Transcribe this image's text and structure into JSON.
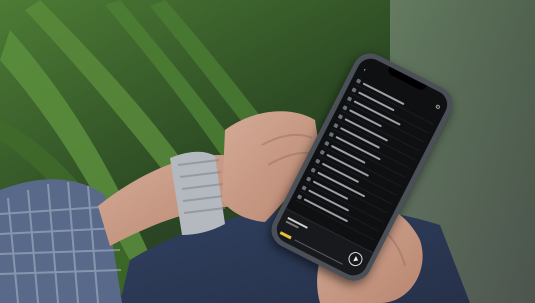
{
  "scene": {
    "description_free": true,
    "colors": {
      "foliage": "#3f6b2a",
      "shirt": "#5b6f8f",
      "jeans": "#2b3a55",
      "skin": "#c99a84",
      "phone": "#4a4f58",
      "screen": "#0f1012",
      "accent": "#e6c23a"
    }
  },
  "phone": {
    "topbar": {
      "back_icon": "chevron-left-icon",
      "title": "",
      "action_icon": "gear-icon"
    },
    "player": {
      "play_icon": "play-icon"
    }
  }
}
